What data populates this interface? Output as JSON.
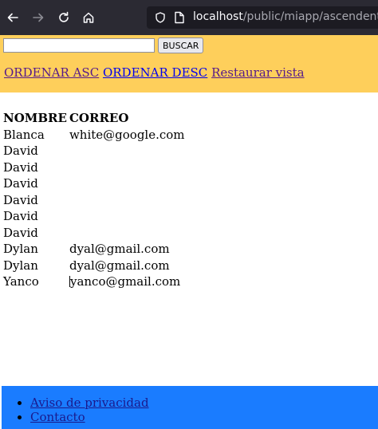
{
  "browser": {
    "url_host": "localhost",
    "url_path": "/public/miapp/ascendente"
  },
  "search": {
    "value": "",
    "placeholder": "",
    "button_label": "BUSCAR"
  },
  "actions": {
    "sort_asc": "ORDENAR ASC",
    "sort_desc": "ORDENAR DESC",
    "restore": "Restaurar vista"
  },
  "table": {
    "headers": [
      "NOMBRE",
      "CORREO"
    ],
    "rows": [
      {
        "name": "Blanca",
        "email": "white@google.com"
      },
      {
        "name": "David",
        "email": ""
      },
      {
        "name": "David",
        "email": ""
      },
      {
        "name": "David",
        "email": ""
      },
      {
        "name": "David",
        "email": ""
      },
      {
        "name": "David",
        "email": ""
      },
      {
        "name": "David",
        "email": ""
      },
      {
        "name": "Dylan",
        "email": "dyal@gmail.com"
      },
      {
        "name": "Dylan",
        "email": "dyal@gmail.com"
      },
      {
        "name": "Yanco",
        "email": "yanco@gmail.com"
      }
    ]
  },
  "footer": {
    "links": [
      "Aviso de privacidad",
      "Contacto"
    ]
  },
  "colors": {
    "chrome": "#2b2a33",
    "top_panel": "#fecf5b",
    "footer": "#1a7cff",
    "link": "#0000ee",
    "visited_link": "#551a8b"
  }
}
